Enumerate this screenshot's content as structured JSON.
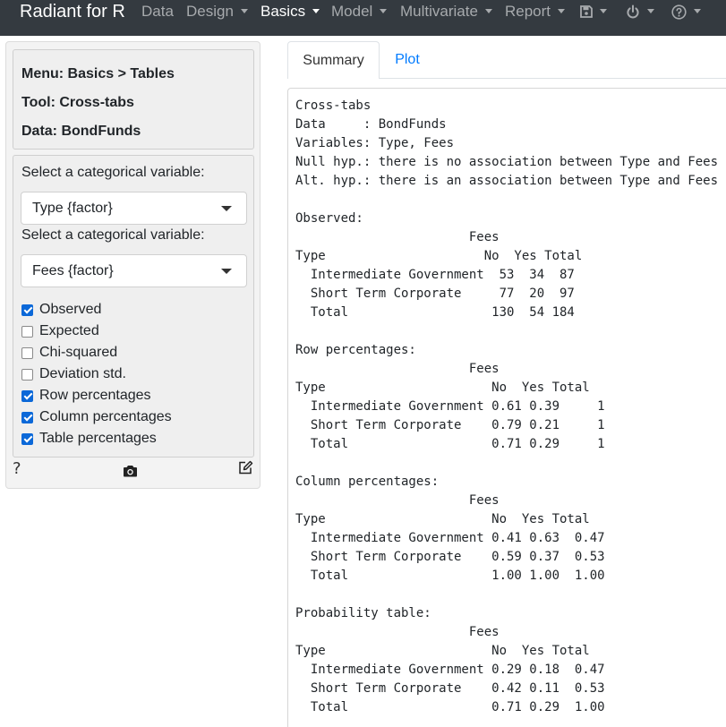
{
  "app": {
    "title": "Radiant for R"
  },
  "navbar": {
    "items": [
      {
        "label": "Data",
        "dropdown": false
      },
      {
        "label": "Design",
        "dropdown": true
      },
      {
        "label": "Basics",
        "dropdown": true,
        "active": true
      },
      {
        "label": "Model",
        "dropdown": true
      },
      {
        "label": "Multivariate",
        "dropdown": true
      },
      {
        "label": "Report",
        "dropdown": true
      }
    ],
    "icons": [
      "save-icon",
      "power-icon",
      "help-circle-icon"
    ]
  },
  "sidebar": {
    "info": {
      "menu": "Menu: Basics > Tables",
      "tool": "Tool: Cross-tabs",
      "data": "Data: BondFunds"
    },
    "select1": {
      "label": "Select a categorical variable:",
      "value": "Type {factor}"
    },
    "select2": {
      "label": "Select a categorical variable:",
      "value": "Fees {factor}"
    },
    "checkboxes": [
      {
        "label": "Observed",
        "checked": true
      },
      {
        "label": "Expected",
        "checked": false
      },
      {
        "label": "Chi-squared",
        "checked": false
      },
      {
        "label": "Deviation std.",
        "checked": false
      },
      {
        "label": "Row percentages",
        "checked": true
      },
      {
        "label": "Column percentages",
        "checked": true
      },
      {
        "label": "Table percentages",
        "checked": true
      }
    ],
    "footer": {
      "help": "?",
      "icons": [
        "camera-icon",
        "edit-icon"
      ]
    }
  },
  "tabs": [
    {
      "label": "Summary",
      "active": true
    },
    {
      "label": "Plot",
      "active": false
    }
  ],
  "colors": {
    "navbar_bg": "#343a40",
    "link": "#007bff",
    "checkbox": "#0b68d8"
  },
  "output": {
    "lines": [
      "Cross-tabs",
      "Data     : BondFunds",
      "Variables: Type, Fees",
      "Null hyp.: there is no association between Type and Fees",
      "Alt. hyp.: there is an association between Type and Fees",
      "",
      "Observed:",
      "                       Fees",
      "Type                     No  Yes Total",
      "  Intermediate Government  53  34  87",
      "  Short Term Corporate     77  20  97",
      "  Total                   130  54 184",
      "",
      "Row percentages:",
      "                       Fees",
      "Type                      No  Yes Total",
      "  Intermediate Government 0.61 0.39     1",
      "  Short Term Corporate    0.79 0.21     1",
      "  Total                   0.71 0.29     1",
      "",
      "Column percentages:",
      "                       Fees",
      "Type                      No  Yes Total",
      "  Intermediate Government 0.41 0.63  0.47",
      "  Short Term Corporate    0.59 0.37  0.53",
      "  Total                   1.00 1.00  1.00",
      "",
      "Probability table:",
      "                       Fees",
      "Type                      No  Yes Total",
      "  Intermediate Government 0.29 0.18  0.47",
      "  Short Term Corporate    0.42 0.11  0.53",
      "  Total                   0.71 0.29  1.00"
    ]
  }
}
